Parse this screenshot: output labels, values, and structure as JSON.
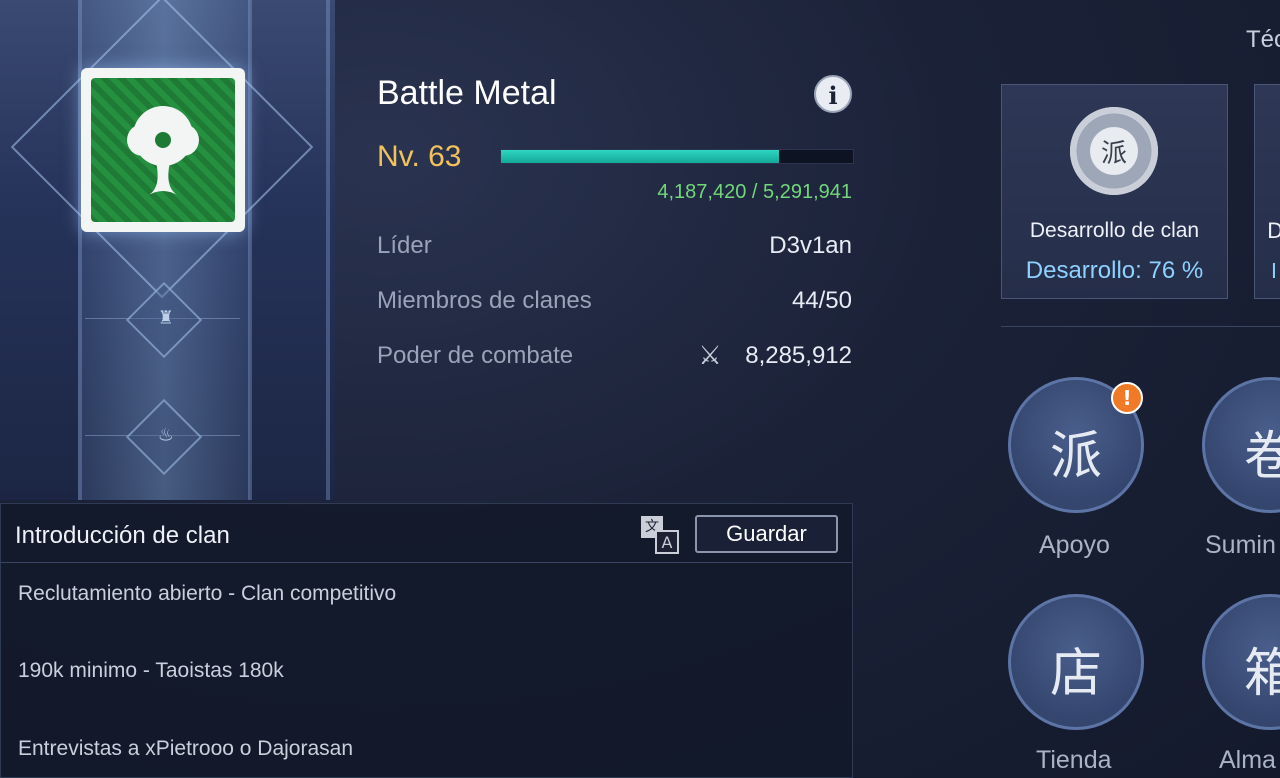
{
  "clan": {
    "name": "Battle Metal",
    "level_label": "Nv. 63",
    "xp_text": "4,187,420 / 5,291,941",
    "xp_progress": 0.791
  },
  "stats": [
    {
      "label": "Líder",
      "value": "D3v1an"
    },
    {
      "label": "Miembros de clanes",
      "value": "44/50"
    },
    {
      "label": "Poder de combate",
      "value": "8,285,912"
    }
  ],
  "intro": {
    "title": "Introducción de clan",
    "save_label": "Guardar",
    "translate_glyph_a": "文",
    "translate_glyph_b": "A",
    "lines": [
      "Reclutamiento abierto - Clan competitivo",
      "190k minimo - Taoistas 180k",
      "Entrevistas a xPietrooo o Dajorasan"
    ]
  },
  "right": {
    "tab_partial": "Téc",
    "dev_card": {
      "glyph": "派",
      "title": "Desarrollo de clan",
      "progress_label": "Desarrollo: 76 %"
    },
    "dev_card2_partial_title": "D",
    "dev_card2_partial_sub": "I",
    "buttons": [
      {
        "label": "Apoyo",
        "glyph": "派",
        "alert": "!"
      },
      {
        "label": "Sumin",
        "glyph": "卷"
      },
      {
        "label": "Tienda",
        "glyph": "店"
      },
      {
        "label": "Alma",
        "glyph": "箱"
      }
    ]
  },
  "icons": {
    "info": "i",
    "power": "⚔"
  },
  "colors": {
    "level": "#f2c35a",
    "xp_fill": "#14a898",
    "xp_text": "#72d77a",
    "dev_pct": "#8fd0ff",
    "alert": "#f07a25",
    "emblem_green": "#1e7a34"
  }
}
